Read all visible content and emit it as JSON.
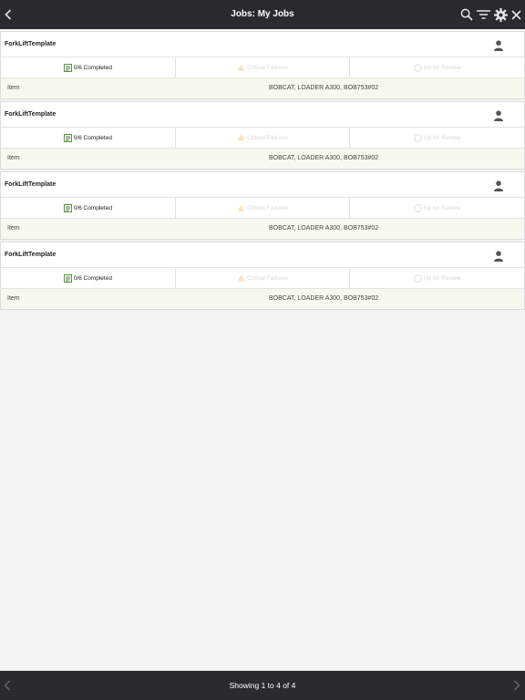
{
  "header": {
    "title": "Jobs: My Jobs",
    "icons": [
      "back-icon",
      "search-icon",
      "filter-icon",
      "gear-icon",
      "close-icon"
    ]
  },
  "jobs": [
    {
      "template": "ForkLiftTemplate",
      "completed": "0/6 Completed",
      "critical": "Critical Failures",
      "review": "Up for Review",
      "item_label": "Item",
      "item_value": "BOBCAT, LOADER A300, BOB753#02"
    },
    {
      "template": "ForkLiftTemplate",
      "completed": "0/6 Completed",
      "critical": "Critical Failures",
      "review": "Up for Review",
      "item_label": "Item",
      "item_value": "BOBCAT, LOADER A300, BOB753#02"
    },
    {
      "template": "ForkLiftTemplate",
      "completed": "0/6 Completed",
      "critical": "Critical Failures",
      "review": "Up for Review",
      "item_label": "Item",
      "item_value": "BOBCAT, LOADER A300, BOB753#02"
    },
    {
      "template": "ForkLiftTemplate",
      "completed": "0/6 Completed",
      "critical": "Critical Failures",
      "review": "Up for Review",
      "item_label": "Item",
      "item_value": "BOBCAT, LOADER A300, BOB753#02"
    }
  ],
  "footer": {
    "pagination_text": "Showing 1 to 4 of 4"
  },
  "colors": {
    "bar_bg": "#2a2b2e",
    "item_row_bg": "#f8f9ee",
    "checklist_green": "#4a9a2a"
  }
}
